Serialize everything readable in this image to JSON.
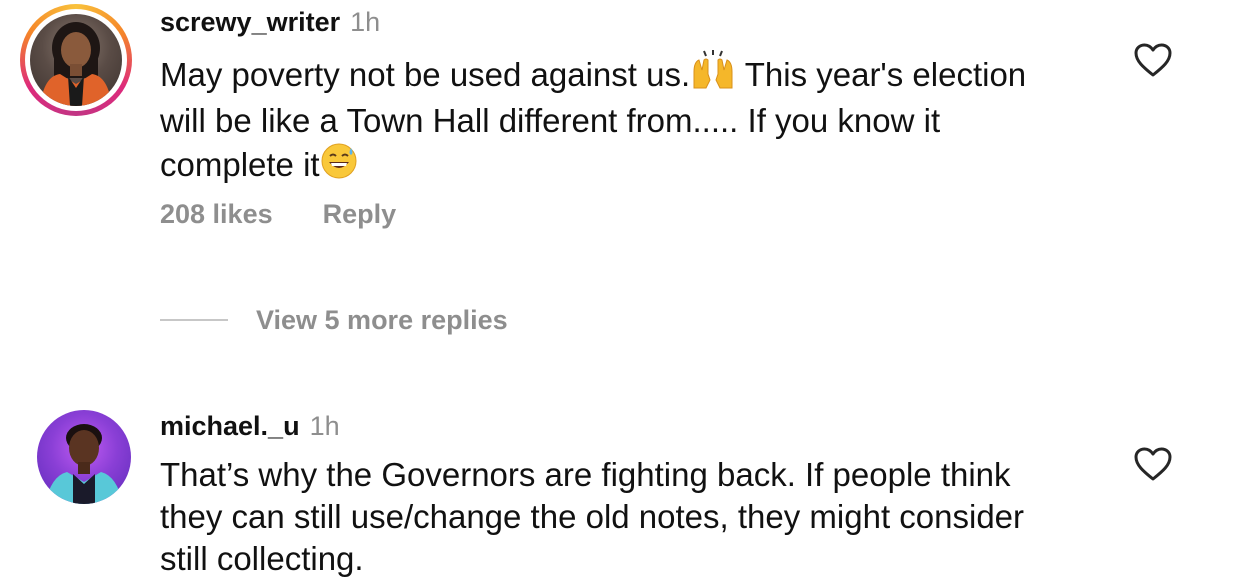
{
  "comments": [
    {
      "username": "screwy_writer",
      "time": "1h",
      "text_before_raise": "May poverty not be used against us.",
      "raise_emoji": "🙌",
      "text_mid_line1": " This year's election will be like a Town Hall different from..... If you know it complete it",
      "sweat_emoji": "😅",
      "likes": "208 likes",
      "reply": "Reply",
      "has_story_ring": true,
      "heart_icon": "heart-outline-icon"
    },
    {
      "username": "michael._u",
      "time": "1h",
      "text": "That’s why the Governors are fighting back. If people think they can still use/change the old notes, they might consider still collecting.",
      "has_story_ring": false,
      "heart_icon": "heart-outline-icon"
    }
  ],
  "view_replies": "View 5 more replies",
  "colors": {
    "text": "#111111",
    "muted": "#8e8e8e",
    "divider": "#c7c7c7"
  }
}
